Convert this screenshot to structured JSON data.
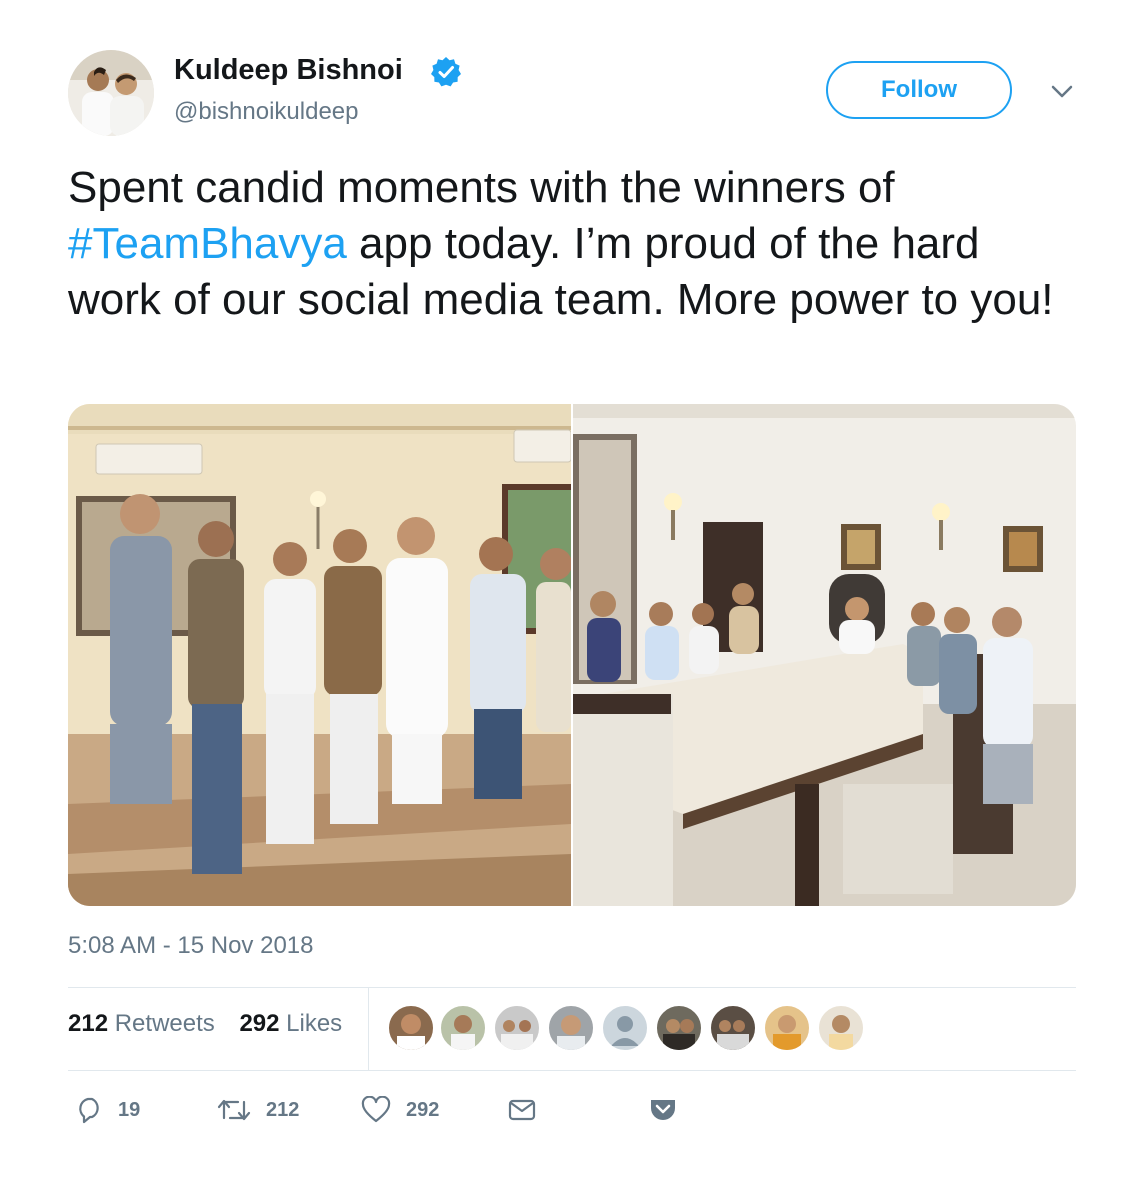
{
  "author": {
    "name": "Kuldeep Bishnoi",
    "handle": "@bishnoikuldeep",
    "verified": true
  },
  "follow_button": {
    "label": "Follow"
  },
  "tweet": {
    "text_before": "Spent candid moments with the winners of ",
    "hashtag": "#TeamBhavya",
    "text_after": " app today. I’m proud of the hard work of our social media team. More power to you!"
  },
  "media": {
    "photos": [
      "group-photo-standing",
      "dining-table-photo"
    ]
  },
  "timestamp": "5:08 AM - 15 Nov 2018",
  "stats": {
    "retweets_count": "212",
    "retweets_label": "Retweets",
    "likes_count": "292",
    "likes_label": "Likes"
  },
  "liked_by_avatars_count": 9,
  "actions": {
    "reply_count": "19",
    "retweet_count": "212",
    "like_count": "292"
  },
  "colors": {
    "accent": "#1da1f2",
    "text_primary": "#14171a",
    "text_secondary": "#657786",
    "divider": "#e1e8ed"
  }
}
